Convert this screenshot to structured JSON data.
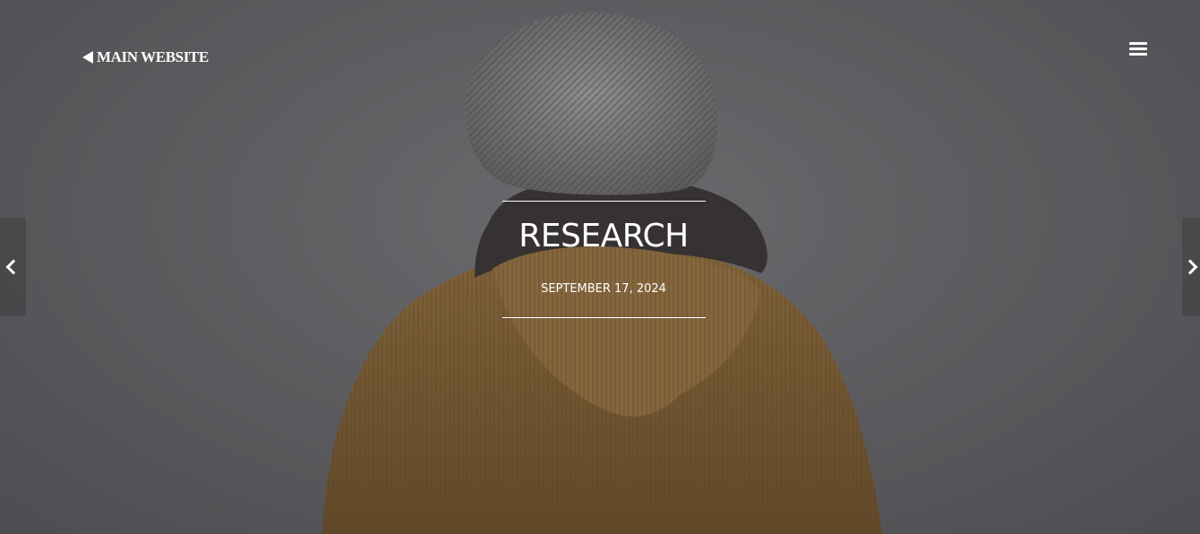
{
  "header": {
    "back_link_label": "MAIN WEBSITE",
    "back_icon": "left-triangle-icon",
    "menu_icon": "hamburger-icon"
  },
  "post": {
    "title": "RESEARCH",
    "date": "SEPTEMBER 17, 2024"
  },
  "slider": {
    "prev_icon": "chevron-left-icon",
    "next_icon": "chevron-right-icon"
  },
  "colors": {
    "background": "#6f6f72",
    "jacket": "#8a6a3c",
    "beanie": "#8c8a8a",
    "text": "#ffffff"
  }
}
